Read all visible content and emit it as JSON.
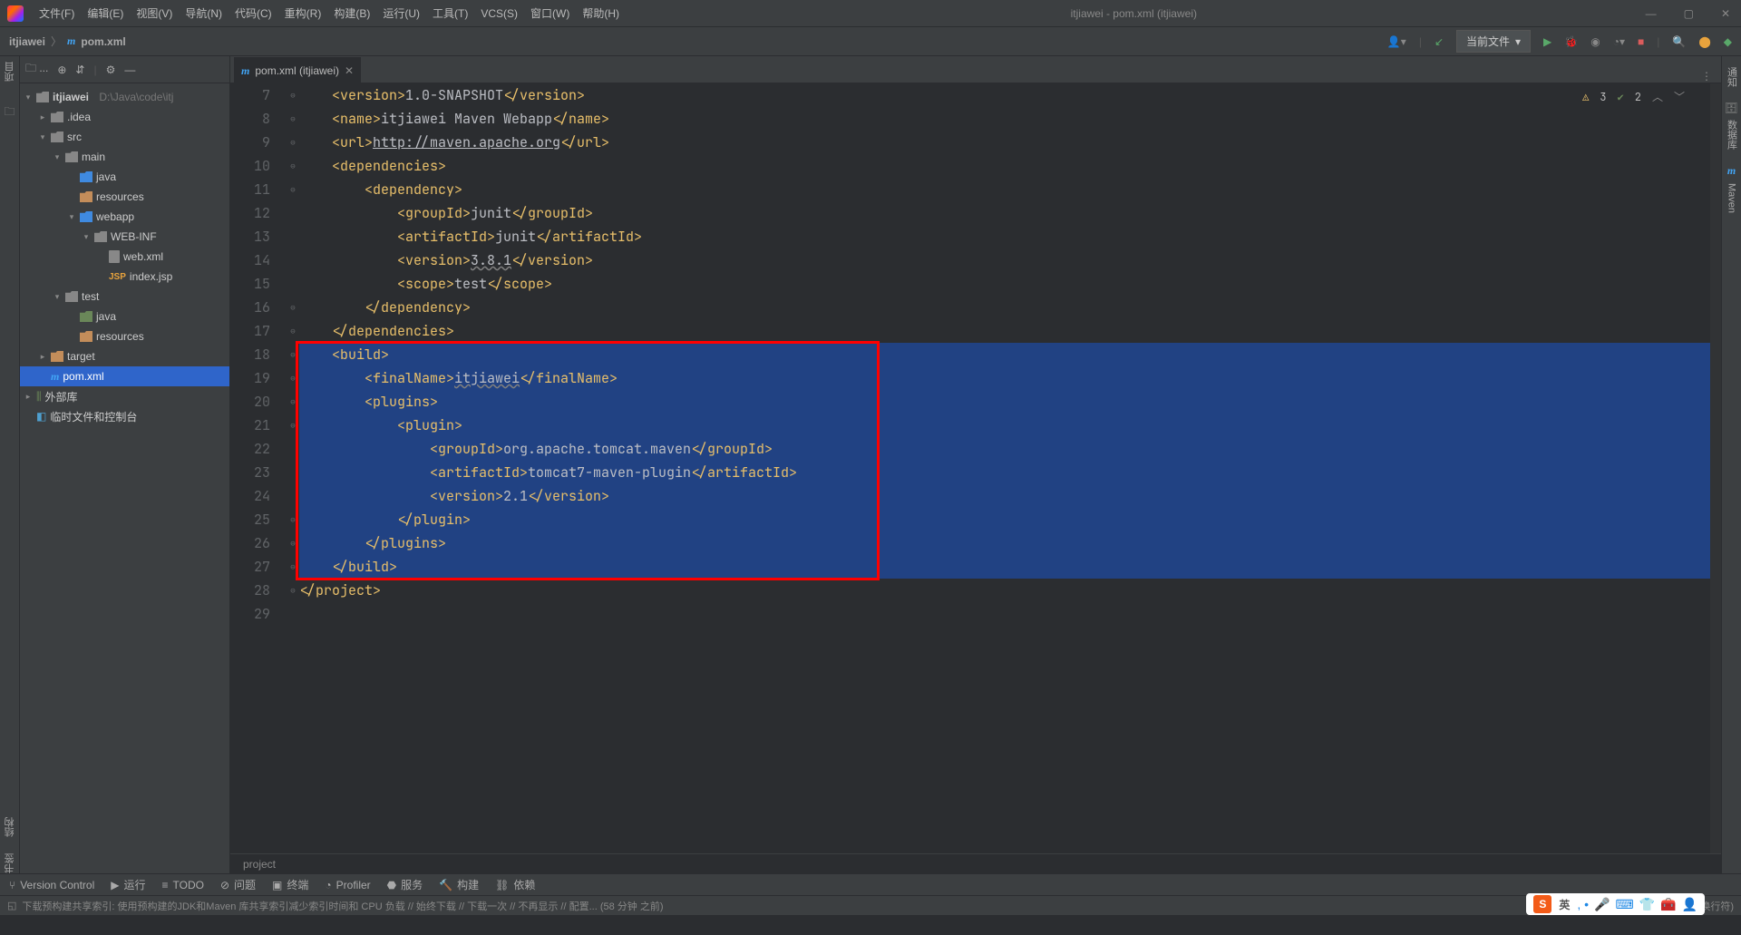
{
  "window": {
    "title": "itjiawei - pom.xml (itjiawei)"
  },
  "menus": {
    "file": "文件(F)",
    "edit": "编辑(E)",
    "view": "视图(V)",
    "navigate": "导航(N)",
    "code": "代码(C)",
    "refactor": "重构(R)",
    "build": "构建(B)",
    "run": "运行(U)",
    "tools": "工具(T)",
    "vcs": "VCS(S)",
    "window": "窗口(W)",
    "help": "帮助(H)"
  },
  "breadcrumb": {
    "project": "itjiawei",
    "file": "pom.xml"
  },
  "nav": {
    "current_file": "当前文件",
    "dropdown_glyph": "▾"
  },
  "project_tree": {
    "root_name": "itjiawei",
    "root_path": "D:\\Java\\code\\itj",
    "idea": ".idea",
    "src": "src",
    "main": "main",
    "java": "java",
    "resources": "resources",
    "webapp": "webapp",
    "webinf": "WEB-INF",
    "webxml": "web.xml",
    "indexjsp": "index.jsp",
    "test": "test",
    "target": "target",
    "pom": "pom.xml",
    "ext_libs": "外部库",
    "scratch": "临时文件和控制台"
  },
  "tab": {
    "label": "pom.xml (itjiawei)"
  },
  "editor_warnings": {
    "errors": "3",
    "oks": "2"
  },
  "gutter_lines": [
    "7",
    "8",
    "9",
    "10",
    "11",
    "12",
    "13",
    "14",
    "15",
    "16",
    "17",
    "18",
    "19",
    "20",
    "21",
    "22",
    "23",
    "24",
    "25",
    "26",
    "27",
    "28",
    "29"
  ],
  "code": {
    "version_snapshot": "1.0-SNAPSHOT",
    "name_val": "itjiawei Maven Webapp",
    "url_val": "http://maven.apache.org",
    "junit_group": "junit",
    "junit_artifact": "junit",
    "junit_version": "3.8.1",
    "scope": "test",
    "final_name": "itjiawei",
    "plugin_group": "org.apache.tomcat.maven",
    "plugin_artifact": "tomcat7-maven-plugin",
    "plugin_version": "2.1"
  },
  "breadcrumb_editor": "project",
  "right_gutter": {
    "notif": "通知",
    "db": "数据库",
    "maven": "Maven"
  },
  "left_gutter": {
    "project": "项目",
    "structure": "结构",
    "bookmarks": "书签"
  },
  "tools": {
    "vcs": "Version Control",
    "run": "运行",
    "todo": "TODO",
    "problems": "问题",
    "terminal": "终端",
    "profiler": "Profiler",
    "services": "服务",
    "build": "构建",
    "deps": "依赖"
  },
  "status": {
    "info": "下载预构建共享索引: 使用预构建的JDK和Maven 库共享索引减少索引时间和 CPU 负载 // 始终下载 // 下载一次 // 不再显示 // 配置... (58 分钟 之前)",
    "pos": "18:1 (258 字符, 9 行 换行符)"
  },
  "ime": {
    "s": "S",
    "lang": "英"
  }
}
